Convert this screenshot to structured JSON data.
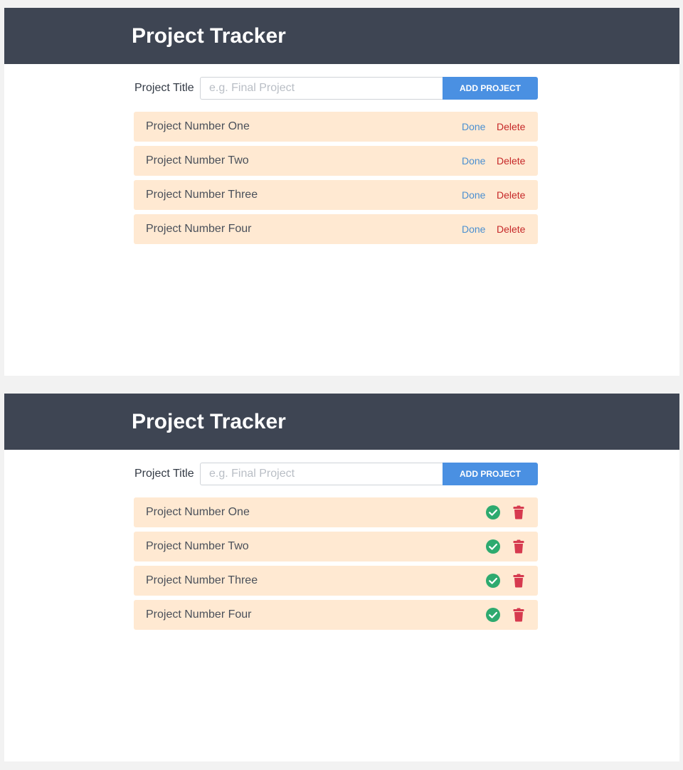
{
  "header": {
    "title": "Project Tracker"
  },
  "form": {
    "label": "Project Title",
    "placeholder": "e.g. Final Project",
    "add_label": "ADD PROJECT"
  },
  "actions": {
    "done_label": "Done",
    "delete_label": "Delete"
  },
  "colors": {
    "header_bg": "#3e4553",
    "button_blue": "#4a90e2",
    "item_bg": "#ffe9d2",
    "done_green": "#2eaa6f",
    "delete_red": "#d63a4f"
  },
  "projects": [
    {
      "name": "Project Number One"
    },
    {
      "name": "Project Number Two"
    },
    {
      "name": "Project Number Three"
    },
    {
      "name": "Project Number Four"
    }
  ],
  "icons": {
    "done": "check-circle-icon",
    "delete": "trash-icon"
  }
}
